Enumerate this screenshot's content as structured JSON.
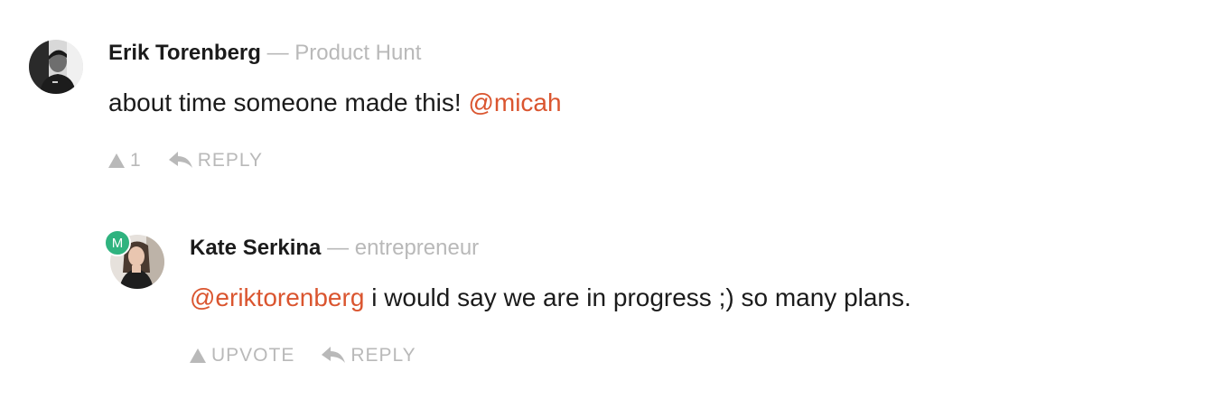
{
  "colors": {
    "mention": "#da552f",
    "muted": "#b9b9b9",
    "text": "#1b1b1b",
    "maker_badge": "#2fb37f"
  },
  "comments": [
    {
      "author": {
        "name": "Erik Torenberg",
        "separator": "—",
        "headline": "Product Hunt",
        "avatar_icon": "user-avatar-photo"
      },
      "body": {
        "text": "about time someone made this!",
        "mention": "@micah"
      },
      "actions": {
        "upvote_label": "1",
        "reply_label": "REPLY"
      }
    },
    {
      "author": {
        "name": "Kate Serkina",
        "separator": "—",
        "headline": "entrepreneur",
        "avatar_icon": "user-avatar-photo",
        "maker_badge": "M"
      },
      "body": {
        "mention": "@eriktorenberg",
        "text": "i would say we are in progress ;) so many plans."
      },
      "actions": {
        "upvote_label": "UPVOTE",
        "reply_label": "REPLY"
      }
    }
  ]
}
